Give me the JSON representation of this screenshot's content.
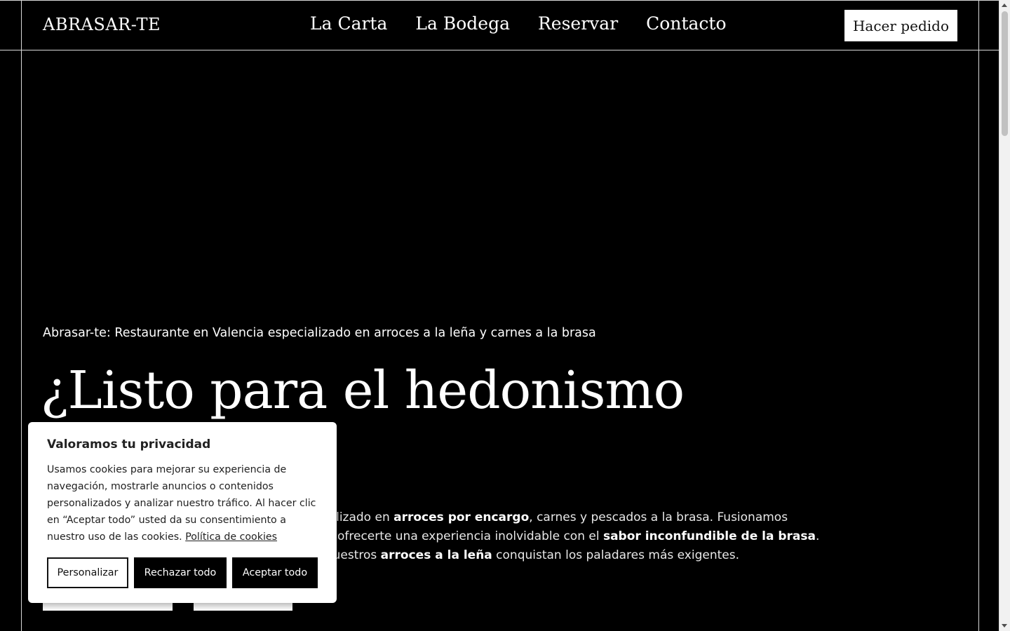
{
  "header": {
    "logo": "ABRASAR-TE",
    "nav": [
      "La Carta",
      "La Bodega",
      "Reservar",
      "Contacto"
    ],
    "order_button": "Hacer pedido"
  },
  "hero": {
    "subtitle": "Abrasar-te: Restaurante en Valencia especializado en arroces a la leña y carnes a la brasa",
    "title": "¿Listo para el hedonismo del fuego?",
    "desc": {
      "p1": "Abrasar-te es un restaurante en Valencia especializado en ",
      "b1": "arroces por encargo",
      "p2": ", carnes y pescados a la brasa. Fusionamos tradición, producto de calidad y creatividad para ofrecerte una experiencia inolvidable con el ",
      "b2": "sabor inconfundible de la brasa",
      "p3": ". Cocinados con mimo y un toque muy especial, nuestros ",
      "b3": "arroces a la leña",
      "p4": " conquistan los paladares más exigentes."
    }
  },
  "cookie": {
    "title": "Valoramos tu privacidad",
    "text": "Usamos cookies para mejorar su experiencia de navegación, mostrarle anuncios o contenidos personalizados y analizar nuestro tráfico. Al hacer clic en “Aceptar todo” usted da su consentimiento a nuestro uso de las cookies.",
    "link": "Política de cookies",
    "customize": "Personalizar",
    "reject": "Rechazar todo",
    "accept": "Aceptar todo"
  }
}
